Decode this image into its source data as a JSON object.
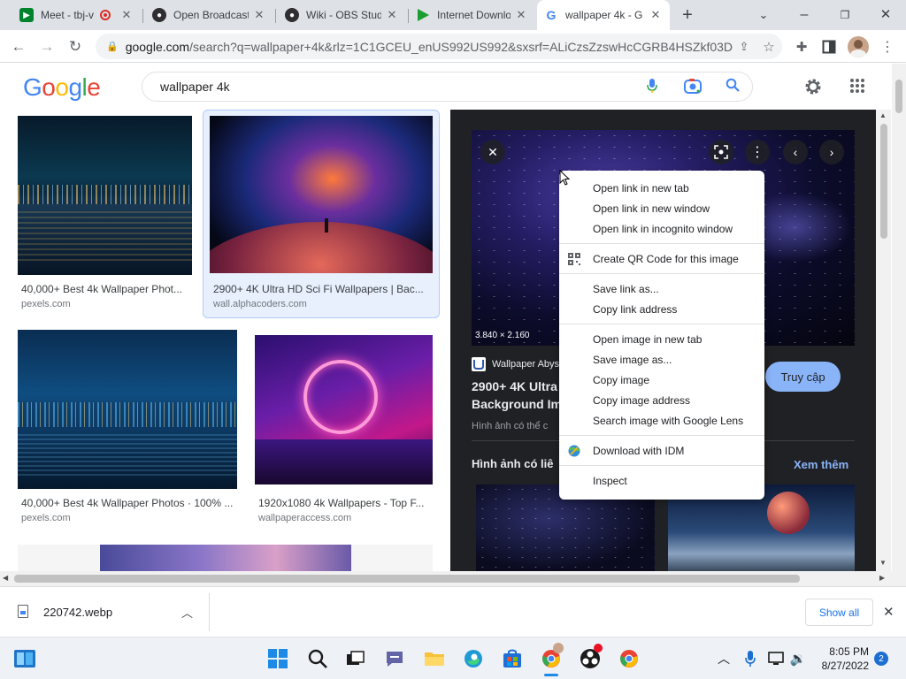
{
  "tabs": [
    {
      "title": "Meet - tbj-v",
      "active": false,
      "icon": "google-meet-icon"
    },
    {
      "title": "Open Broadcast",
      "active": false,
      "icon": "obs-icon"
    },
    {
      "title": "Wiki - OBS Studi",
      "active": false,
      "icon": "obs-icon"
    },
    {
      "title": "Internet Downlo",
      "active": false,
      "icon": "idm-icon"
    },
    {
      "title": "wallpaper 4k - G",
      "active": true,
      "icon": "google-icon"
    }
  ],
  "address": {
    "host": "google.com",
    "rest": "/search?q=wallpaper+4k&rlz=1C1GCEU_enUS992US992&sxsrf=ALiCzsZzswHcCGRB4HSZkf03D..."
  },
  "google": {
    "logo_letters": [
      "G",
      "o",
      "o",
      "g",
      "l",
      "e"
    ],
    "logo_colors": [
      "#4285f4",
      "#ea4335",
      "#fbbc05",
      "#4285f4",
      "#34a853",
      "#ea4335"
    ],
    "query": "wallpaper 4k"
  },
  "results": [
    {
      "caption": "40,000+ Best 4k Wallpaper Phot...",
      "source": "pexels.com"
    },
    {
      "caption": "2900+ 4K Ultra HD Sci Fi Wallpapers | Bac...",
      "source": "wall.alphacoders.com"
    },
    {
      "caption": "40,000+ Best 4k Wallpaper Photos · 100% ...",
      "source": "pexels.com"
    },
    {
      "caption": "1920x1080 4k Wallpapers - Top F...",
      "source": "wallpaperaccess.com"
    }
  ],
  "panel": {
    "dimensions": "3.840 × 2.160",
    "site": "Wallpaper Abys",
    "title_line1": "2900+ 4K Ultra",
    "title_line2": "Background Im",
    "subtext": "Hình ảnh có thể c",
    "visit_button": "Truy cập",
    "related_heading": "Hình ảnh có liê",
    "see_more": "Xem thêm"
  },
  "context_menu": {
    "group1": [
      "Open link in new tab",
      "Open link in new window",
      "Open link in incognito window"
    ],
    "qr": "Create QR Code for this image",
    "group2": [
      "Save link as...",
      "Copy link address"
    ],
    "group3": [
      "Open image in new tab",
      "Save image as...",
      "Copy image",
      "Copy image address",
      "Search image with Google Lens"
    ],
    "idm": "Download with IDM",
    "inspect": "Inspect"
  },
  "download": {
    "filename": "220742.webp",
    "show_all": "Show all"
  },
  "clock": {
    "time": "8:05 PM",
    "date": "8/27/2022",
    "notifications": "2"
  },
  "colors": {
    "tabstrip": "#dee1e6",
    "panel": "#202124",
    "accent_blue": "#8ab4f8"
  }
}
